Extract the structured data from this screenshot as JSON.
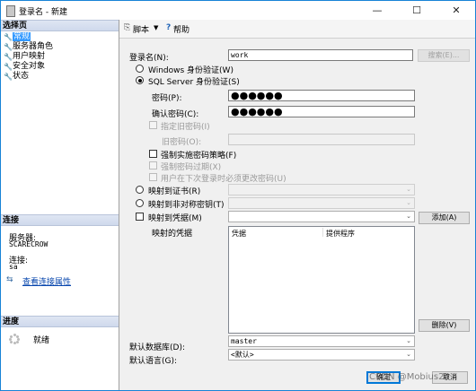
{
  "window": {
    "title": "登录名 - 新建",
    "minimize": "—",
    "maximize": "☐",
    "close": "✕"
  },
  "sidebar": {
    "select_page_header": "选择页",
    "pages": [
      {
        "label": "常规",
        "selected": true
      },
      {
        "label": "服务器角色",
        "selected": false
      },
      {
        "label": "用户映射",
        "selected": false
      },
      {
        "label": "安全对象",
        "selected": false
      },
      {
        "label": "状态",
        "selected": false
      }
    ],
    "connection_header": "连接",
    "server_label": "服务器:",
    "server_value": "SCARECROW",
    "connection_label": "连接:",
    "connection_value": "sa",
    "view_connection_link": "查看连接属性",
    "progress_header": "进度",
    "progress_status": "就绪"
  },
  "toolbar": {
    "script_label": "脚本",
    "help_label": "帮助"
  },
  "form": {
    "login_name_label": "登录名(N):",
    "login_name_value": "work",
    "search_button": "搜索(E)...",
    "windows_auth_label": "Windows 身份验证(W)",
    "sql_auth_label": "SQL Server 身份验证(S)",
    "password_label": "密码(P):",
    "password_value": "●●●●●●",
    "confirm_password_label": "确认密码(C):",
    "confirm_password_value": "●●●●●●",
    "specify_old_password_label": "指定旧密码(I)",
    "old_password_label": "旧密码(O):",
    "old_password_value": "",
    "enforce_policy_label": "强制实施密码策略(F)",
    "enforce_expiration_label": "强制密码过期(X)",
    "must_change_label": "用户在下次登录时必须更改密码(U)",
    "map_certificate_label": "映射到证书(R)",
    "map_asym_key_label": "映射到非对称密钥(T)",
    "map_credential_label": "映射到凭据(M)",
    "add_button": "添加(A)",
    "mapped_credentials_label": "映射的凭据",
    "credentials_table": {
      "columns": [
        "凭据",
        "提供程序"
      ],
      "rows": []
    },
    "remove_button": "删除(V)",
    "default_database_label": "默认数据库(D):",
    "default_database_value": "master",
    "default_language_label": "默认语言(G):",
    "default_language_value": "<默认>",
    "ok_button": "确定",
    "cancel_button": "取消"
  },
  "watermark": "CSDN @Mobius24",
  "colors": {
    "accent": "#1883d7",
    "selection": "#3399ff",
    "link": "#0645ad"
  }
}
